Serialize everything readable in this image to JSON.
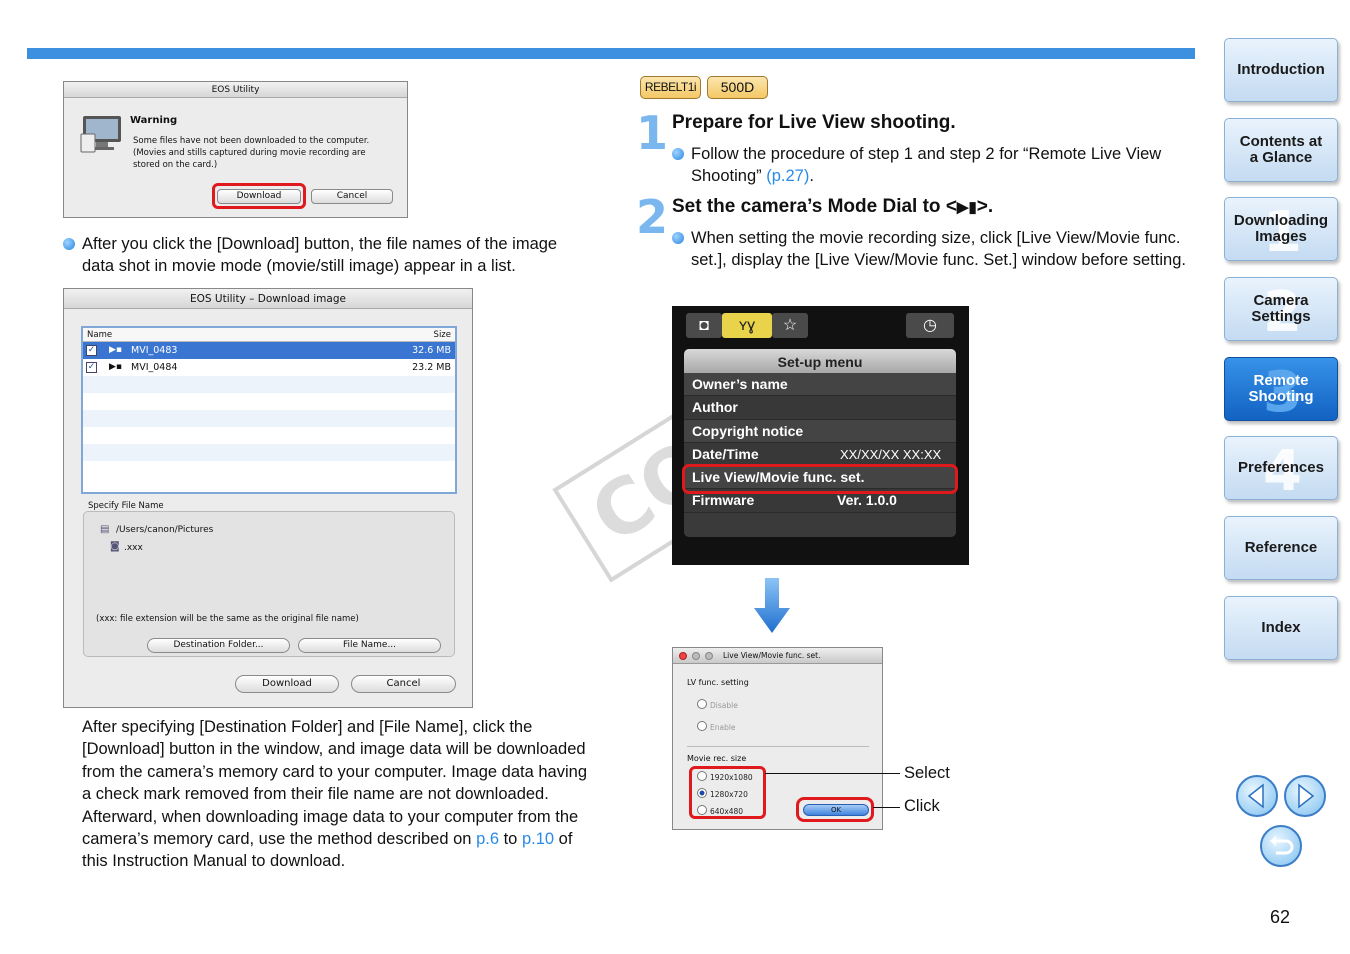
{
  "page": {
    "number": "62"
  },
  "warning_dialog": {
    "title": "EOS Utility",
    "heading": "Warning",
    "message": "Some files have not been downloaded to the computer.\n(Movies and stills captured during movie recording are\nstored on the card.)",
    "download_label": "Download",
    "cancel_label": "Cancel"
  },
  "bullet_after_download": "After you click the [Download] button, the file names of the image data shot in movie mode (movie/still image) appear in a list.",
  "download_dialog": {
    "title": "EOS Utility – Download image",
    "col_name": "Name",
    "col_size": "Size",
    "files": [
      {
        "name": "MVI_0483",
        "size": "32.6 MB"
      },
      {
        "name": "MVI_0484",
        "size": "23.2 MB"
      }
    ],
    "specify_label": "Specify File Name",
    "path": "/Users/canon/Pictures",
    "ext": ".xxx",
    "note": "(xxx: file extension will be the same as the original file name)",
    "dest_btn": "Destination Folder...",
    "filename_btn": "File Name...",
    "download_btn": "Download",
    "cancel_btn": "Cancel"
  },
  "body_text": {
    "main": "After specifying [Destination Folder] and [File Name], click the [Download] button in the window, and image data will be downloaded from the camera’s memory card to your computer. Image data having a check mark removed from their file name are not downloaded. Afterward, when downloading image data to your computer from the camera’s memory card, use the method described on ",
    "link1": "p.6",
    "mid": " to ",
    "link2": "p.10",
    "end": " of this Instruction Manual to download."
  },
  "model_tags": [
    "REBELT1i",
    "500D"
  ],
  "steps": [
    {
      "num": "1",
      "title": "Prepare for Live View shooting.",
      "bullet": "Follow the procedure of step 1 and step 2 for “Remote Live View Shooting” ",
      "link": "(p.27)",
      "tail": "."
    },
    {
      "num": "2",
      "title_pre": "Set the camera’s Mode Dial to <",
      "title_post": ">.",
      "bullet": "When setting the movie recording size, click [Live View/Movie func. set.], display the [Live View/Movie func. Set.] window before setting."
    }
  ],
  "camera_menu": {
    "header": "Set-up menu",
    "items": [
      {
        "label": "Owner’s name",
        "value": ""
      },
      {
        "label": "Author",
        "value": ""
      },
      {
        "label": "Copyright notice",
        "value": ""
      },
      {
        "label": "Date/Time",
        "value": "XX/XX/XX XX:XX"
      },
      {
        "label": "Live View/Movie func. set.",
        "value": ""
      },
      {
        "label": "Firmware",
        "value": "Ver. 1.0.0"
      }
    ]
  },
  "lv_dialog": {
    "title": "Live View/Movie func. set.",
    "lv_label": "LV func. setting",
    "disable": "Disable",
    "enable": "Enable",
    "movie_label": "Movie rec. size",
    "sizes": [
      "1920x1080",
      "1280x720",
      "640x480"
    ],
    "ok": "OK"
  },
  "callouts": {
    "select": "Select",
    "click": "Click"
  },
  "watermark": "COPY",
  "nav": [
    {
      "label": "Introduction",
      "num": ""
    },
    {
      "label": "Contents at\na Glance",
      "num": ""
    },
    {
      "label": "Downloading\nImages",
      "num": "1"
    },
    {
      "label": "Camera\nSettings",
      "num": "2"
    },
    {
      "label": "Remote\nShooting",
      "num": "3"
    },
    {
      "label": "Preferences",
      "num": "4"
    },
    {
      "label": "Reference",
      "num": ""
    },
    {
      "label": "Index",
      "num": ""
    }
  ],
  "colors": {
    "accent": "#3d8fe0",
    "highlight_red": "#e0191c",
    "link": "#2a8ae6"
  }
}
